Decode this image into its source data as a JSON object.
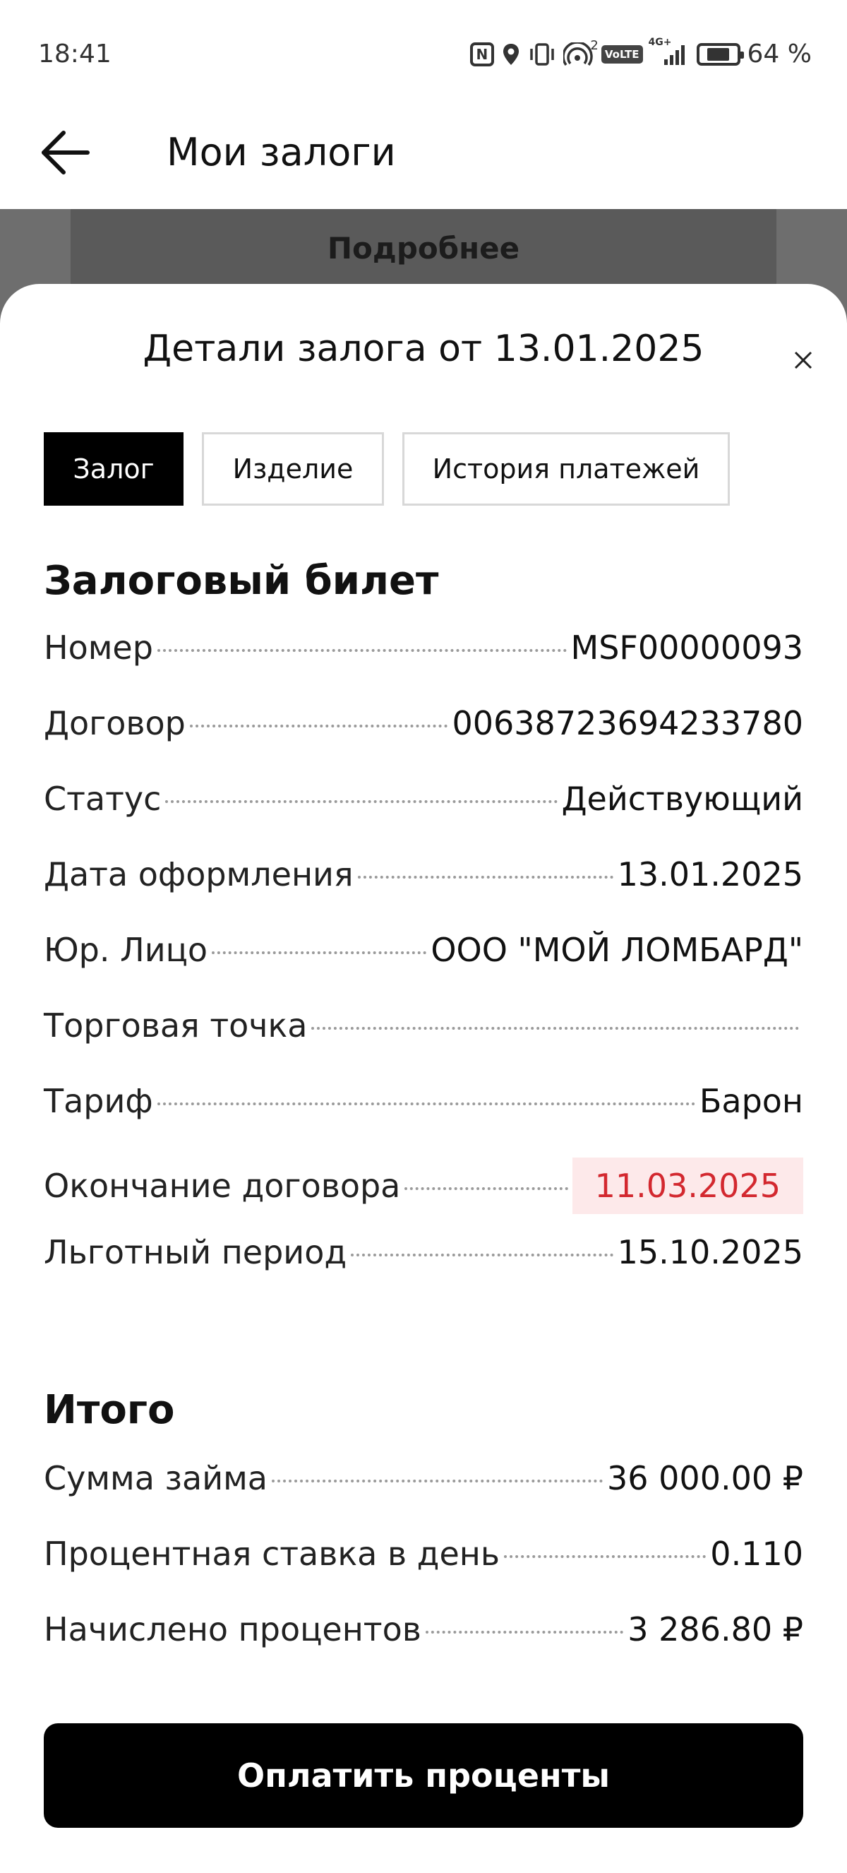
{
  "status_bar": {
    "time": "18:41",
    "hotspot_count": "2",
    "volte": "VoLTE",
    "network": "4G+",
    "battery": "64 %",
    "battery_level": 0.64,
    "icons": [
      "nfc-icon",
      "location-icon",
      "vibrate-icon",
      "hotspot-icon",
      "volte-icon",
      "signal-icon",
      "battery-icon"
    ]
  },
  "header": {
    "title": "Мои залоги",
    "back_icon": "arrow-left-icon"
  },
  "background": {
    "details_button": "Подробнее"
  },
  "sheet": {
    "title": "Детали залога от 13.01.2025",
    "close_icon": "close-icon",
    "tabs": [
      {
        "label": "Залог",
        "active": true
      },
      {
        "label": "Изделие",
        "active": false
      },
      {
        "label": "История платежей",
        "active": false
      }
    ],
    "ticket": {
      "title": "Залоговый билет",
      "rows": [
        {
          "label": "Номер",
          "value": "MSF00000093"
        },
        {
          "label": "Договор",
          "value": "00638723694233780"
        },
        {
          "label": "Статус",
          "value": "Действующий"
        },
        {
          "label": "Дата оформления",
          "value": "13.01.2025"
        },
        {
          "label": "Юр. Лицо",
          "value": "ООО \"МОЙ ЛОМБАРД\""
        },
        {
          "label": "Торговая точка",
          "value": ""
        },
        {
          "label": "Тариф",
          "value": "Барон"
        },
        {
          "label": "Окончание договора",
          "value": "11.03.2025"
        },
        {
          "label": "Льготный период",
          "value": "15.10.2025"
        }
      ]
    },
    "totals": {
      "title": "Итого",
      "rows": [
        {
          "label": "Сумма займа",
          "value": "36 000.00 ₽"
        },
        {
          "label": "Процентная ставка в день",
          "value": "0.110"
        },
        {
          "label": "Начислено процентов",
          "value": "3 286.80 ₽"
        }
      ]
    },
    "pay_button": "Оплатить проценты"
  },
  "colors": {
    "accent": "#000000",
    "alert_text": "#d3282f",
    "alert_bg": "#fde9ea"
  }
}
